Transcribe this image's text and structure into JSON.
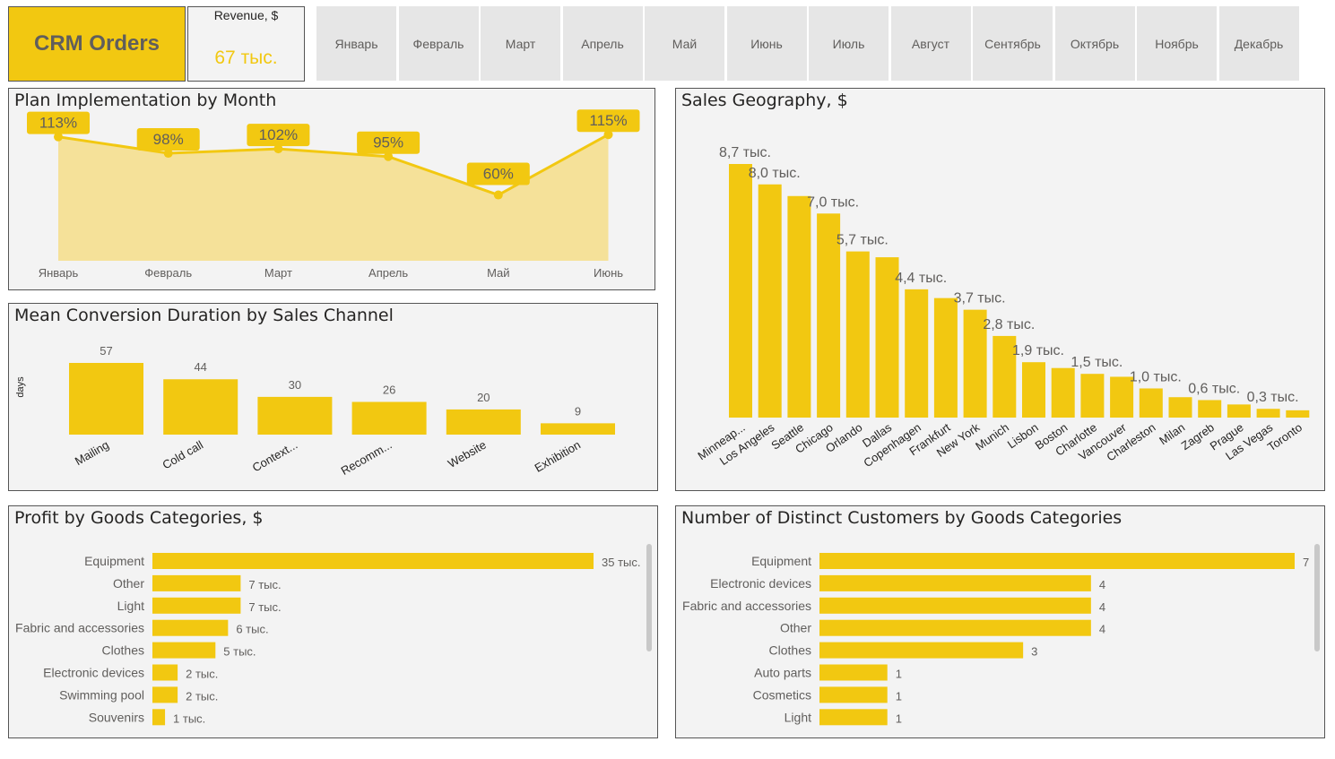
{
  "header": {
    "app_title": "CRM Orders",
    "kpi_label": "Revenue, $",
    "kpi_value": "67 тыс.",
    "months": [
      "Январь",
      "Февраль",
      "Март",
      "Апрель",
      "Май",
      "Июнь",
      "Июль",
      "Август",
      "Сентябрь",
      "Октябрь",
      "Ноябрь",
      "Декабрь"
    ]
  },
  "colors": {
    "accent": "#F2C811",
    "area": "#F5E199",
    "panel_bg": "#F3F3F3",
    "tile_bg": "#E6E6E6"
  },
  "charts": {
    "plan": {
      "title": "Plan Implementation by Month",
      "chart_data": {
        "type": "area",
        "categories": [
          "Январь",
          "Февраль",
          "Март",
          "Апрель",
          "Май",
          "Июнь"
        ],
        "values": [
          113,
          98,
          102,
          95,
          60,
          115
        ],
        "labels": [
          "113%",
          "98%",
          "102%",
          "95%",
          "60%",
          "115%"
        ],
        "ylim": [
          0,
          120
        ]
      }
    },
    "geo": {
      "title": "Sales Geography, $",
      "chart_data": {
        "type": "bar",
        "categories": [
          "Minneap...",
          "Los Angeles",
          "Seattle",
          "Chicago",
          "Orlando",
          "Dallas",
          "Copenhagen",
          "Frankfurt",
          "New York",
          "Munich",
          "Lisbon",
          "Boston",
          "Charlotte",
          "Vancouver",
          "Charleston",
          "Milan",
          "Zagreb",
          "Prague",
          "Las Vegas",
          "Toronto"
        ],
        "values": [
          8.7,
          8.0,
          7.6,
          7.0,
          5.7,
          5.5,
          4.4,
          4.1,
          3.7,
          2.8,
          1.9,
          1.7,
          1.5,
          1.4,
          1.0,
          0.7,
          0.6,
          0.45,
          0.3,
          0.25
        ],
        "labels": [
          "8,7 тыс.",
          "8,0 тыс.",
          "",
          "7,0 тыс.",
          "5,7 тыс.",
          "",
          "4,4 тыс.",
          "",
          "3,7 тыс.",
          "2,8 тыс.",
          "1,9 тыс.",
          "",
          "1,5 тыс.",
          "",
          "1,0 тыс.",
          "",
          "0,6 тыс.",
          "",
          "0,3 тыс.",
          ""
        ],
        "ylim": [
          0,
          8.7
        ]
      }
    },
    "channel": {
      "title": "Mean Conversion Duration by Sales Channel",
      "chart_data": {
        "type": "bar",
        "categories": [
          "Mailing",
          "Cold call",
          "Context...",
          "Recomm...",
          "Website",
          "Exhibition"
        ],
        "values": [
          57,
          44,
          30,
          26,
          20,
          9
        ],
        "ylabel": "days",
        "ylim": [
          0,
          57
        ]
      }
    },
    "profit": {
      "title": "Profit by Goods Categories, $",
      "chart_data": {
        "type": "bar",
        "orientation": "horizontal",
        "categories": [
          "Equipment",
          "Other",
          "Light",
          "Fabric and accessories",
          "Clothes",
          "Electronic devices",
          "Swimming pool",
          "Souvenirs"
        ],
        "values": [
          35,
          7,
          7,
          6,
          5,
          2,
          2,
          1
        ],
        "labels": [
          "35 тыс.",
          "7 тыс.",
          "7 тыс.",
          "6 тыс.",
          "5 тыс.",
          "2 тыс.",
          "2 тыс.",
          "1 тыс."
        ],
        "xlim": [
          0,
          35
        ]
      }
    },
    "customers": {
      "title": "Number of Distinct Customers by Goods Categories",
      "chart_data": {
        "type": "bar",
        "orientation": "horizontal",
        "categories": [
          "Equipment",
          "Electronic devices",
          "Fabric and accessories",
          "Other",
          "Clothes",
          "Auto parts",
          "Cosmetics",
          "Light"
        ],
        "values": [
          7,
          4,
          4,
          4,
          3,
          1,
          1,
          1
        ],
        "labels": [
          "7",
          "4",
          "4",
          "4",
          "3",
          "1",
          "1",
          "1"
        ],
        "xlim": [
          0,
          7
        ]
      }
    }
  }
}
